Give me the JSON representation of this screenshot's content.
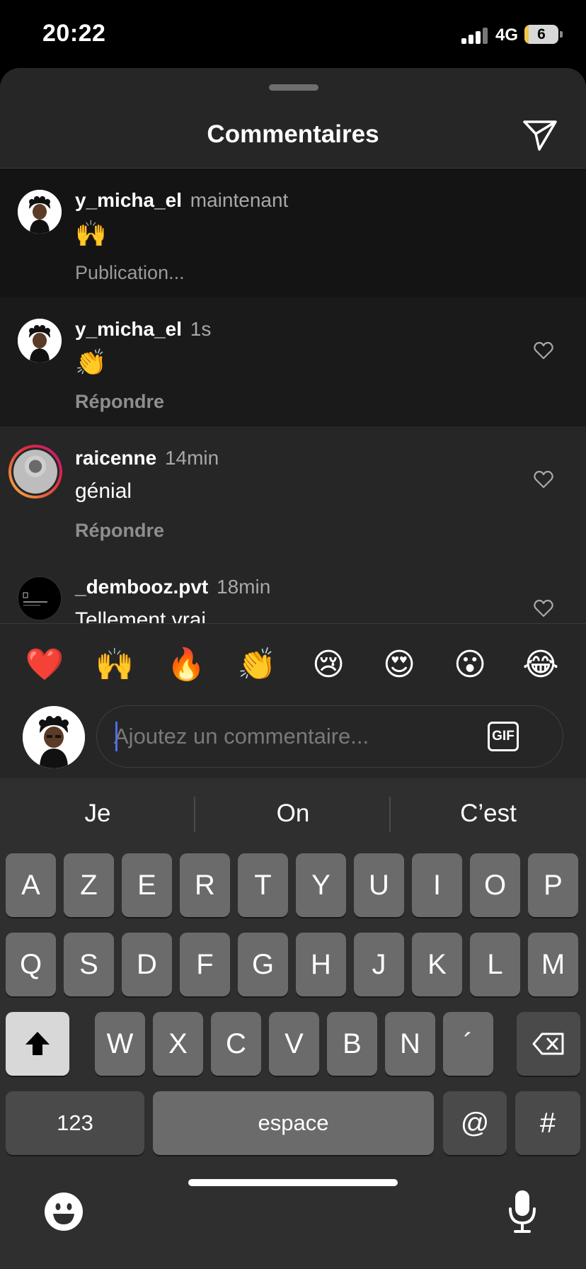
{
  "status_bar": {
    "time": "20:22",
    "network": "4G",
    "battery": "6",
    "battery_level": 0.06
  },
  "sheet": {
    "title": "Commentaires"
  },
  "comments": [
    {
      "user": "y_micha_el",
      "time": "maintenant",
      "text": "🙌",
      "action": "Publication..."
    },
    {
      "user": "y_micha_el",
      "time": "1s",
      "text": "👏",
      "action": "Répondre"
    },
    {
      "user": "raicenne",
      "time": "14min",
      "text": "génial",
      "action": "Répondre"
    },
    {
      "user": "_dembooz.pvt",
      "time": "18min",
      "text": "Tellement vrai",
      "action": ""
    }
  ],
  "emoji_bar": [
    "❤️",
    "🙌",
    "🔥",
    "👏",
    "😢",
    "😍",
    "😮",
    "😂"
  ],
  "comment_input": {
    "placeholder": "Ajoutez un commentaire...",
    "gif_label": "GIF"
  },
  "keyboard": {
    "suggestions": [
      "Je",
      "On",
      "C’est"
    ],
    "row1": [
      "A",
      "Z",
      "E",
      "R",
      "T",
      "Y",
      "U",
      "I",
      "O",
      "P"
    ],
    "row2": [
      "Q",
      "S",
      "D",
      "F",
      "G",
      "H",
      "J",
      "K",
      "L",
      "M"
    ],
    "row3": [
      "W",
      "X",
      "C",
      "V",
      "B",
      "N",
      "´"
    ],
    "numbers_label": "123",
    "space_label": "espace",
    "at_label": "@",
    "hash_label": "#"
  },
  "colors": {
    "accent": "#4f6df0",
    "sheet": "#262626",
    "keyboard": "#2f2f2f"
  }
}
